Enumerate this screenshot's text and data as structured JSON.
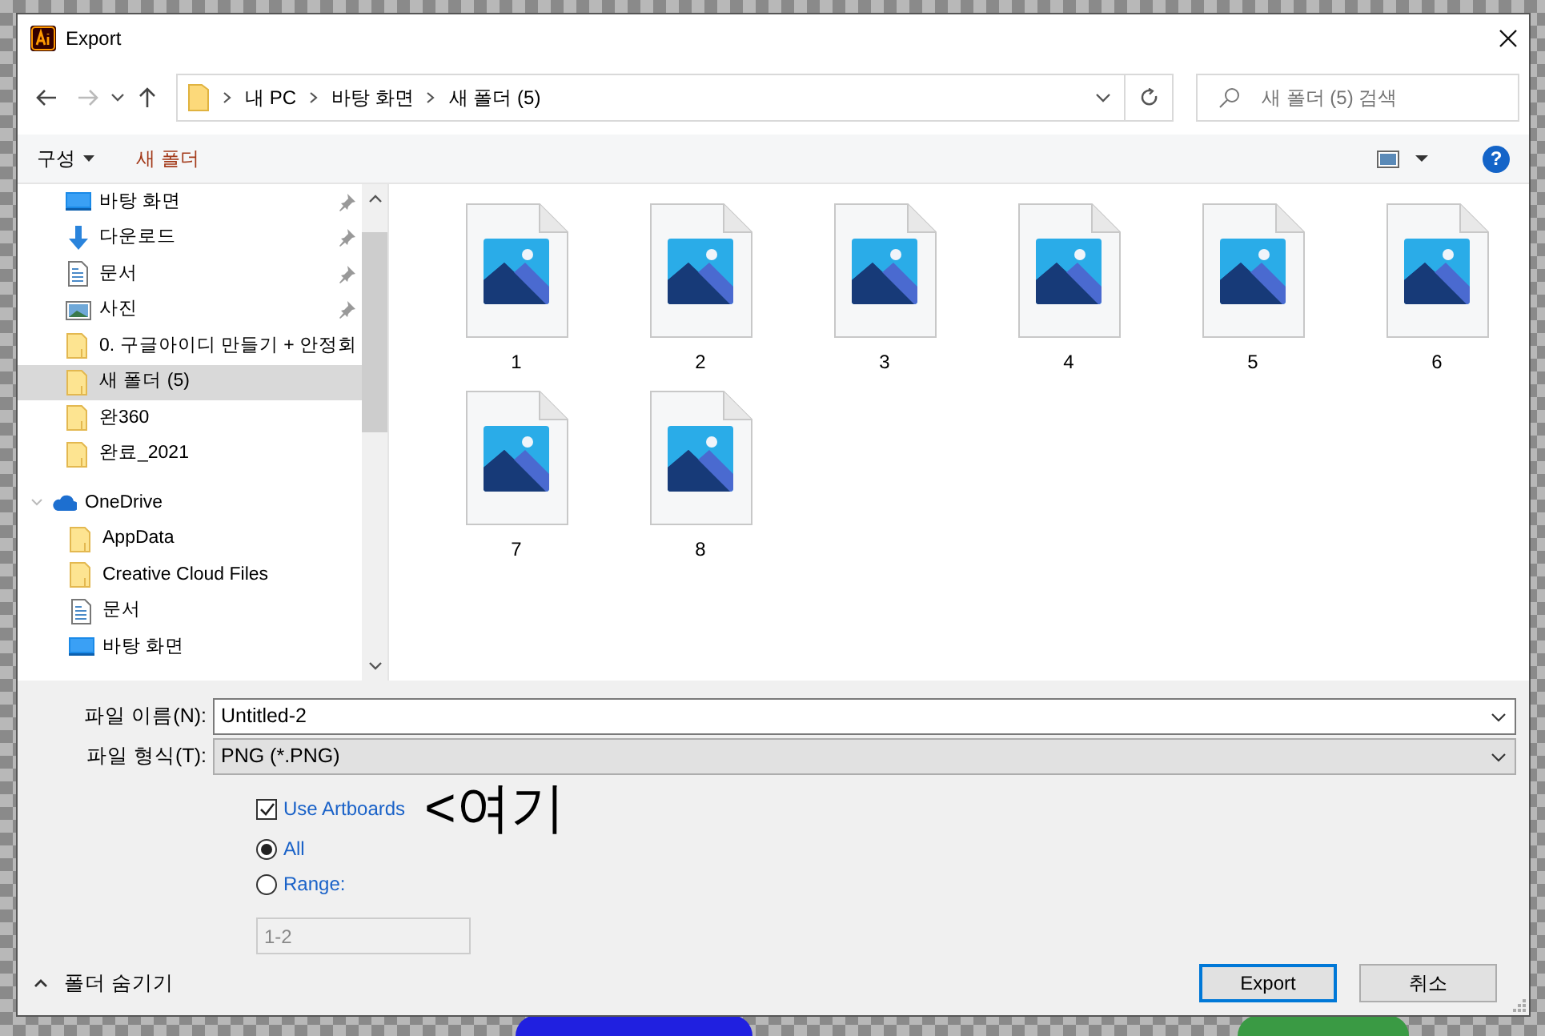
{
  "window": {
    "title": "Export"
  },
  "address": {
    "crumbs": [
      "내 PC",
      "바탕 화면",
      "새 폴더 (5)"
    ]
  },
  "search": {
    "placeholder": "새 폴더 (5) 검색"
  },
  "nav": {
    "back_disabled": false,
    "forward_disabled": true
  },
  "toolbar": {
    "organize": "구성",
    "new_folder": "새 폴더",
    "help": "?"
  },
  "sidebar": {
    "items": [
      {
        "label": "바탕 화면",
        "kind": "desktop",
        "pinned": true,
        "selected": false
      },
      {
        "label": "다운로드",
        "kind": "download",
        "pinned": true,
        "selected": false
      },
      {
        "label": "문서",
        "kind": "document",
        "pinned": true,
        "selected": false
      },
      {
        "label": "사진",
        "kind": "pictures",
        "pinned": true,
        "selected": false
      },
      {
        "label": "0. 구글아이디 만들기 + 안정회",
        "kind": "folder",
        "pinned": false,
        "selected": false
      },
      {
        "label": "새 폴더 (5)",
        "kind": "folder",
        "pinned": false,
        "selected": true
      },
      {
        "label": "완360",
        "kind": "folder",
        "pinned": false,
        "selected": false
      },
      {
        "label": "완료_2021",
        "kind": "folder",
        "pinned": false,
        "selected": false
      },
      {
        "label": "OneDrive",
        "kind": "cloud",
        "pinned": false,
        "selected": false,
        "expanded": true,
        "children": [
          {
            "label": "AppData",
            "kind": "folder",
            "pinned": false,
            "selected": false
          },
          {
            "label": "Creative Cloud Files",
            "kind": "folder",
            "pinned": false,
            "selected": false
          },
          {
            "label": "문서",
            "kind": "document",
            "pinned": false,
            "selected": false
          },
          {
            "label": "바탕 화면",
            "kind": "desktop",
            "pinned": false,
            "selected": false
          }
        ]
      }
    ]
  },
  "files": [
    "1",
    "2",
    "3",
    "4",
    "5",
    "6",
    "7",
    "8"
  ],
  "form": {
    "name_label": "파일 이름(N):",
    "name_value": "Untitled-2",
    "type_label": "파일 형식(T):",
    "type_value": "PNG (*.PNG)"
  },
  "options": {
    "use_artboards": {
      "label": "Use Artboards",
      "checked": true
    },
    "note": "<여기",
    "radios": [
      {
        "label": "All",
        "selected": true
      },
      {
        "label": "Range:",
        "selected": false
      }
    ],
    "range": {
      "value": "1-2",
      "disabled": true
    }
  },
  "footer": {
    "hide_folders": "폴더 숨기기",
    "buttons": [
      {
        "label": "Export",
        "default": true
      },
      {
        "label": "취소",
        "default": false
      }
    ]
  }
}
